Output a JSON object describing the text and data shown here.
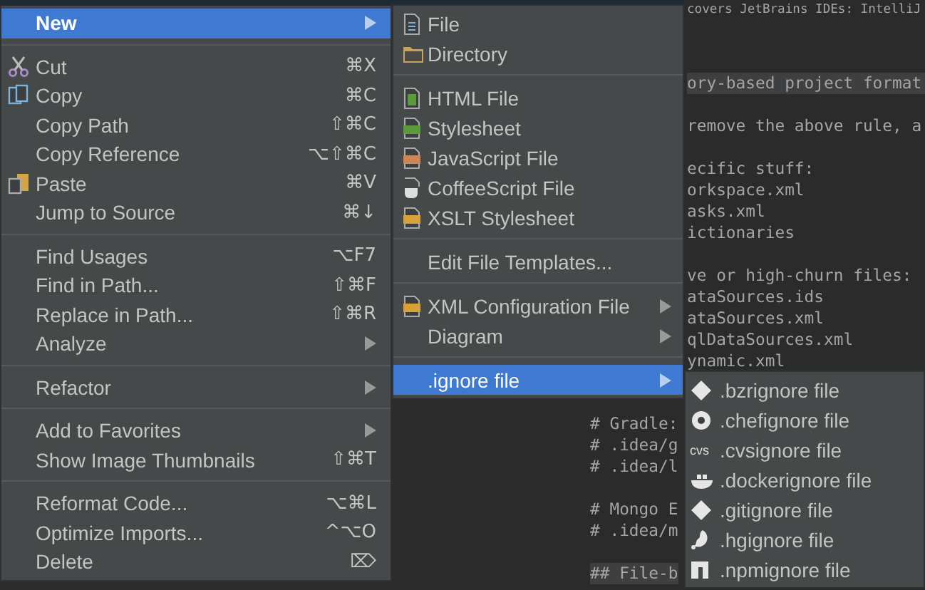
{
  "editor": {
    "upper_blocks": [
      {
        "highlighted": false,
        "lines": [
          "covers JetBrains IDEs: IntelliJ"
        ]
      },
      {
        "highlighted": true,
        "lines": [
          "ory-based project format"
        ]
      },
      {
        "highlighted": false,
        "lines": [
          "remove the above rule, a"
        ]
      },
      {
        "highlighted": false,
        "lines": [
          "ecific stuff:",
          "orkspace.xml",
          "asks.xml",
          "ictionaries"
        ]
      },
      {
        "highlighted": false,
        "lines": [
          "ve or high-churn files:",
          "ataSources.ids",
          "ataSources.xml",
          "qlDataSources.xml",
          "ynamic.xml"
        ]
      }
    ],
    "lower_blocks": [
      {
        "highlighted": false,
        "lines": [
          "# Gradle:",
          "# .idea/g",
          "# .idea/l"
        ]
      },
      {
        "highlighted": false,
        "lines": [
          "# Mongo E",
          "# .idea/m"
        ]
      },
      {
        "highlighted": true,
        "lines": [
          "## File-b"
        ]
      }
    ]
  },
  "context_menu": {
    "items": [
      {
        "kind": "item",
        "label": "New",
        "submenu": true,
        "selected": true
      },
      {
        "kind": "separator"
      },
      {
        "kind": "item",
        "label": "Cut",
        "shortcut": "⌘X",
        "submenu": false,
        "selected": false
      },
      {
        "kind": "item",
        "label": "Copy",
        "shortcut": "⌘C",
        "submenu": false,
        "selected": false
      },
      {
        "kind": "item",
        "label": "Copy Path",
        "shortcut": "⇧⌘C",
        "submenu": false,
        "selected": false
      },
      {
        "kind": "item",
        "label": "Copy Reference",
        "shortcut": "⌥⇧⌘C",
        "submenu": false,
        "selected": false
      },
      {
        "kind": "item",
        "label": "Paste",
        "shortcut": "⌘V",
        "submenu": false,
        "selected": false
      },
      {
        "kind": "item",
        "label": "Jump to Source",
        "shortcut": "⌘↓",
        "submenu": false,
        "selected": false
      },
      {
        "kind": "separator"
      },
      {
        "kind": "item",
        "label": "Find Usages",
        "shortcut": "⌥F7",
        "submenu": false,
        "selected": false
      },
      {
        "kind": "item",
        "label": "Find in Path...",
        "shortcut": "⇧⌘F",
        "submenu": false,
        "selected": false
      },
      {
        "kind": "item",
        "label": "Replace in Path...",
        "shortcut": "⇧⌘R",
        "submenu": false,
        "selected": false
      },
      {
        "kind": "item",
        "label": "Analyze",
        "submenu": true,
        "selected": false
      },
      {
        "kind": "separator"
      },
      {
        "kind": "item",
        "label": "Refactor",
        "submenu": true,
        "selected": false
      },
      {
        "kind": "separator"
      },
      {
        "kind": "item",
        "label": "Add to Favorites",
        "submenu": true,
        "selected": false
      },
      {
        "kind": "item",
        "label": "Show Image Thumbnails",
        "shortcut": "⇧⌘T",
        "submenu": false,
        "selected": false
      },
      {
        "kind": "separator"
      },
      {
        "kind": "item",
        "label": "Reformat Code...",
        "shortcut": "⌥⌘L",
        "submenu": false,
        "selected": false
      },
      {
        "kind": "item",
        "label": "Optimize Imports...",
        "shortcut": "^⌥O",
        "submenu": false,
        "selected": false
      },
      {
        "kind": "item",
        "label": "Delete",
        "shortcut": "⌦",
        "submenu": false,
        "selected": false
      }
    ]
  },
  "new_submenu": {
    "items": [
      {
        "kind": "item",
        "label": "File",
        "submenu": false,
        "selected": false
      },
      {
        "kind": "item",
        "label": "Directory",
        "submenu": false,
        "selected": false
      },
      {
        "kind": "separator"
      },
      {
        "kind": "item",
        "label": "HTML File",
        "submenu": false,
        "selected": false
      },
      {
        "kind": "item",
        "label": "Stylesheet",
        "submenu": false,
        "selected": false
      },
      {
        "kind": "item",
        "label": "JavaScript File",
        "submenu": false,
        "selected": false
      },
      {
        "kind": "item",
        "label": "CoffeeScript File",
        "submenu": false,
        "selected": false
      },
      {
        "kind": "item",
        "label": "XSLT Stylesheet",
        "submenu": false,
        "selected": false
      },
      {
        "kind": "separator"
      },
      {
        "kind": "item",
        "label": "Edit File Templates...",
        "submenu": false,
        "selected": false
      },
      {
        "kind": "separator"
      },
      {
        "kind": "item",
        "label": "XML Configuration File",
        "submenu": true,
        "selected": false
      },
      {
        "kind": "item",
        "label": "Diagram",
        "submenu": true,
        "selected": false
      },
      {
        "kind": "separator"
      },
      {
        "kind": "item",
        "label": ".ignore file",
        "submenu": true,
        "selected": true
      }
    ]
  },
  "ignore_submenu": {
    "items": [
      {
        "kind": "item",
        "label": ".bzrignore file",
        "submenu": false,
        "selected": false
      },
      {
        "kind": "item",
        "label": ".chefignore file",
        "submenu": false,
        "selected": false
      },
      {
        "kind": "item",
        "label": ".cvsignore file",
        "badge": "cvs",
        "submenu": false,
        "selected": false
      },
      {
        "kind": "item",
        "label": ".dockerignore file",
        "submenu": false,
        "selected": false
      },
      {
        "kind": "item",
        "label": ".gitignore file",
        "submenu": false,
        "selected": false
      },
      {
        "kind": "item",
        "label": ".hgignore file",
        "submenu": false,
        "selected": false
      },
      {
        "kind": "item",
        "label": ".npmignore file",
        "submenu": false,
        "selected": false
      }
    ]
  }
}
